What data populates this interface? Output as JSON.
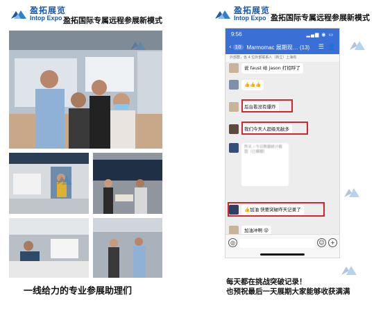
{
  "brand": {
    "name_cn": "盈拓展览",
    "name_en": "Intop Expo",
    "accent": "#1e5aa8"
  },
  "left": {
    "title": "盈拓国际专属远程参展新模式",
    "caption": "一线给力的专业参展助理们"
  },
  "right": {
    "title": "盈拓国际专属远程参展新模式",
    "caption_line1": "每天都在挑战突破记录！",
    "caption_line2": "也预祝最后一天展期大家能够收获满满"
  },
  "phone": {
    "time": "9:56",
    "status_icons": "▂▄▆ ◉ ▭",
    "back_count": "10",
    "chat_title": "Marmomac 展期现… (13)",
    "sub_text": "外部群，含 4 位外部联系人（新立）上海有",
    "messages": [
      {
        "text": "说 faust 给 jason 打招呼了"
      },
      {
        "text": "👍👍👍"
      },
      {
        "text": "后台看没有爆炸"
      },
      {
        "text": "我们今天人超级无敌多"
      },
      {
        "text": "昨天 / 今日数据统计截图（已模糊）"
      },
      {
        "text": "👍加油 快要突破昨天记录了"
      },
      {
        "text": "加油冲啊 😜"
      }
    ],
    "highlight_color": "#d8232a",
    "bar_color": "#3a6fd6"
  }
}
